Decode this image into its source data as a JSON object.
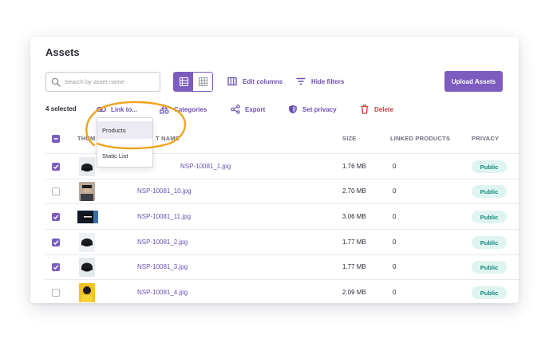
{
  "page": {
    "title": "Assets"
  },
  "search": {
    "placeholder": "Search by asset name",
    "value": ""
  },
  "toolbar": {
    "edit_columns": "Edit columns",
    "hide_filters": "Hide filters",
    "upload_label": "Upload Assets"
  },
  "actions": {
    "selected_text": "4 selected",
    "link_to": "Link to...",
    "categories": "Categories",
    "export": "Export",
    "set_privacy": "Set privacy",
    "delete": "Delete"
  },
  "dropdown": {
    "items": [
      {
        "label": "Products",
        "hovered": true
      },
      {
        "label": "Static List",
        "hovered": false
      }
    ]
  },
  "table": {
    "headers": {
      "thumbnail": "THUM",
      "name": "T NAME",
      "size": "SIZE",
      "linked_products": "LINKED PRODUCTS",
      "privacy": "PRIVACY"
    },
    "rows": [
      {
        "checked": true,
        "name": "NSP-10081_1.jpg",
        "size": "1.76 MB",
        "linked": "0",
        "privacy": "Public"
      },
      {
        "checked": false,
        "name": "NSP-10081_10.jpg",
        "size": "2.70 MB",
        "linked": "0",
        "privacy": "Public"
      },
      {
        "checked": true,
        "name": "NSP-10081_11.jpg",
        "size": "3.06 MB",
        "linked": "0",
        "privacy": "Public"
      },
      {
        "checked": true,
        "name": "NSP-10081_2.jpg",
        "size": "1.77 MB",
        "linked": "0",
        "privacy": "Public"
      },
      {
        "checked": true,
        "name": "NSP-10081_3.jpg",
        "size": "1.77 MB",
        "linked": "0",
        "privacy": "Public"
      },
      {
        "checked": false,
        "name": "NSP-10081_4.jpg",
        "size": "2.09 MB",
        "linked": "0",
        "privacy": "Public"
      }
    ]
  },
  "colors": {
    "accent": "#7c5cbf",
    "link": "#6b4fb3",
    "danger": "#d23b3b",
    "badge_bg": "#dff4f1",
    "badge_text": "#138a7c",
    "highlight_ring": "#f2a31b"
  }
}
